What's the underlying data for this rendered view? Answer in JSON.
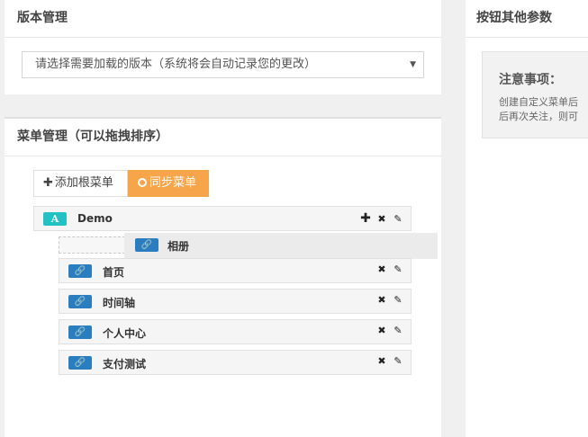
{
  "version_panel": {
    "title": "版本管理",
    "select_value": "请选择需要加载的版本（系统将会自动记录您的更改）",
    "caret": "▼"
  },
  "menu_panel": {
    "title": "菜单管理（可以拖拽排序）",
    "add_root_label": "添加根菜单",
    "add_icon": "✚",
    "sync_label": "同步菜单",
    "root": {
      "badge": "A",
      "label": "Demo"
    },
    "dragging": {
      "label": "相册"
    },
    "children": [
      {
        "label": "首页"
      },
      {
        "label": "时间轴"
      },
      {
        "label": "个人中心"
      },
      {
        "label": "支付测试"
      }
    ],
    "icons": {
      "link": "🔗",
      "add": "✚",
      "delete": "✖",
      "edit": "✎"
    }
  },
  "params_panel": {
    "title": "按钮其他参数",
    "notice_title": "注意事项：",
    "notice_lines": [
      "创建自定义菜单后",
      "后再次关注，则可"
    ]
  }
}
